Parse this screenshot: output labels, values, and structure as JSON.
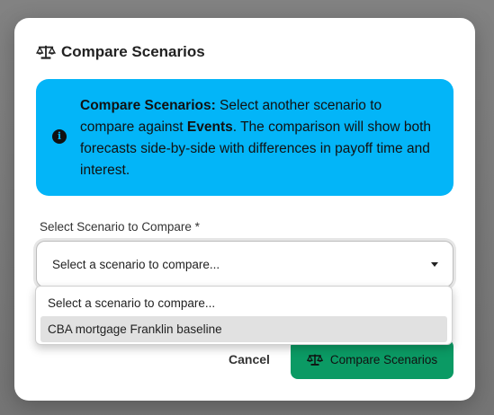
{
  "modal": {
    "title": "Compare Scenarios",
    "title_icon": "scale-balance-icon"
  },
  "alert": {
    "icon": "info-circle-icon",
    "heading": "Compare Scenarios:",
    "text_1": " Select another scenario to compare against ",
    "scenario_name": "Events",
    "text_2": ". The comparison will show both forecasts side-by-side with differences in payoff time and interest.",
    "color": "#03b5f8"
  },
  "form": {
    "label": "Select Scenario to Compare *",
    "selected_value": "Select a scenario to compare...",
    "options": [
      "Select a scenario to compare...",
      "CBA mortgage Franklin baseline"
    ],
    "highlighted_option_index": 1
  },
  "actions": {
    "cancel_label": "Cancel",
    "compare_label": "Compare Scenarios",
    "compare_icon": "scale-balance-icon",
    "compare_color": "#0b9a64"
  }
}
